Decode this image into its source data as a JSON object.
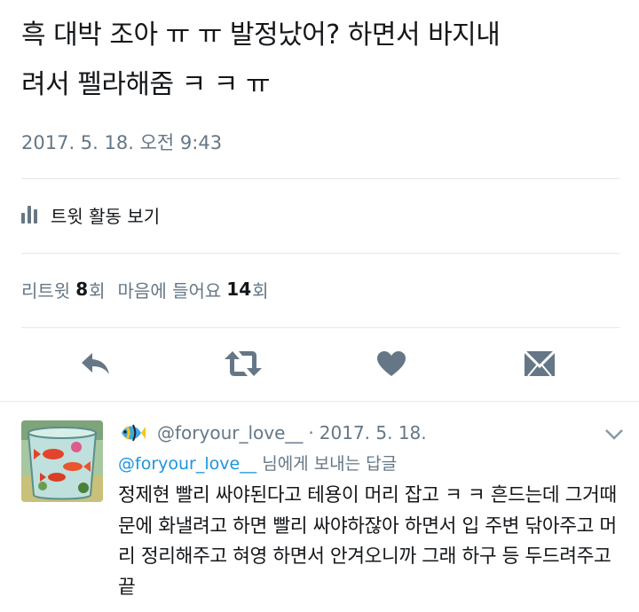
{
  "tweet": {
    "text": "흑 대박 조아 ㅠ ㅠ 발정났어? 하면서 바지내\n려서 펠라해줌 ㅋ ㅋ ㅠ",
    "timestamp": "2017. 5. 18. 오전 9:43",
    "activity_label": "트윗 활동 보기",
    "retweets_label": "리트윗",
    "retweets_count": "8",
    "retweets_suffix": "회",
    "likes_label": "마음에 들어요",
    "likes_count": "14",
    "likes_suffix": "회"
  },
  "actions": {
    "reply_icon": "reply-icon",
    "retweet_icon": "retweet-icon",
    "like_icon": "heart-icon",
    "dm_icon": "envelope-icon"
  },
  "reply": {
    "handle": "@foryour_love__",
    "separator": "·",
    "date": "2017. 5. 18.",
    "reply_to_mention": "@foryour_love__",
    "reply_to_suffix": " 님에게 보내는 답글",
    "text": "정제현 빨리 싸야된다고 테용이 머리 잡고 ㅋ ㅋ 흔드는데 그거때문에 화낼려고 하면 빨리 싸야하잖아 하면서 입 주변 닦아주고 머리 정리해주고 혀영 하면서 안겨오니까 그래 하구 등 두드려주고 끝"
  },
  "colors": {
    "text": "#14171a",
    "secondary": "#657786",
    "link": "#1b95e0",
    "divider": "#e1e8ed",
    "icon": "#657786"
  }
}
